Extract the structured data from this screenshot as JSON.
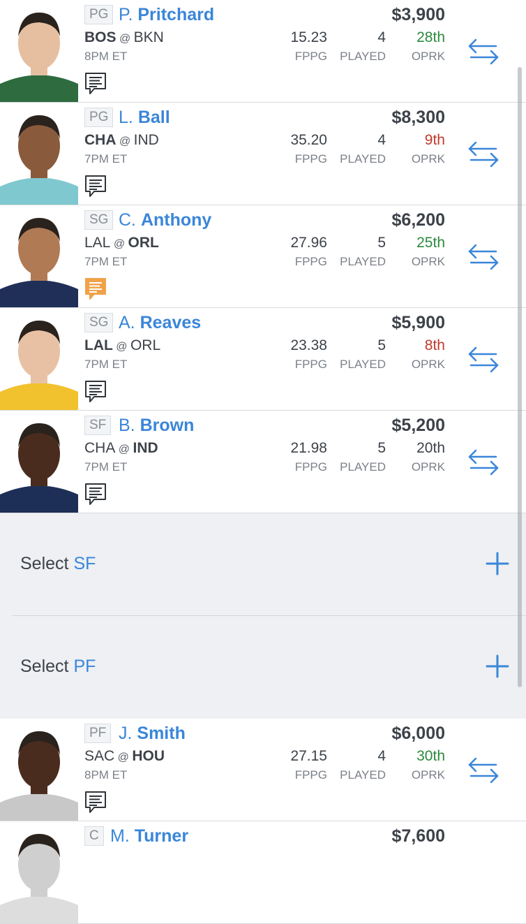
{
  "players": [
    {
      "pos": "PG",
      "initial": "P.",
      "last": "Pritchard",
      "salary": "$3,900",
      "team": "BOS",
      "opp": "BKN",
      "home_bold": "team",
      "time": "8PM ET",
      "fppg": "15.23",
      "fppg_label": "FPPG",
      "played": "4",
      "played_label": "PLAYED",
      "oprk": "28th",
      "oprk_label": "OPRK",
      "oprk_tone": "good",
      "note": "default",
      "jersey": "#2e6b3e",
      "skin": "#e6bfa0"
    },
    {
      "pos": "PG",
      "initial": "L.",
      "last": "Ball",
      "salary": "$8,300",
      "team": "CHA",
      "opp": "IND",
      "home_bold": "team",
      "time": "7PM ET",
      "fppg": "35.20",
      "fppg_label": "FPPG",
      "played": "4",
      "played_label": "PLAYED",
      "oprk": "9th",
      "oprk_label": "OPRK",
      "oprk_tone": "bad",
      "note": "default",
      "jersey": "#7fc8cf",
      "skin": "#8a5a3c"
    },
    {
      "pos": "SG",
      "initial": "C.",
      "last": "Anthony",
      "salary": "$6,200",
      "team": "LAL",
      "opp": "ORL",
      "home_bold": "opp",
      "time": "7PM ET",
      "fppg": "27.96",
      "fppg_label": "FPPG",
      "played": "5",
      "played_label": "PLAYED",
      "oprk": "25th",
      "oprk_label": "OPRK",
      "oprk_tone": "good",
      "note": "highlight",
      "jersey": "#1f2f57",
      "skin": "#b07a55"
    },
    {
      "pos": "SG",
      "initial": "A.",
      "last": "Reaves",
      "salary": "$5,900",
      "team": "LAL",
      "opp": "ORL",
      "home_bold": "team",
      "time": "7PM ET",
      "fppg": "23.38",
      "fppg_label": "FPPG",
      "played": "5",
      "played_label": "PLAYED",
      "oprk": "8th",
      "oprk_label": "OPRK",
      "oprk_tone": "bad",
      "note": "default",
      "jersey": "#f2c12e",
      "skin": "#e8c1a4"
    },
    {
      "pos": "SF",
      "initial": "B.",
      "last": "Brown",
      "salary": "$5,200",
      "team": "CHA",
      "opp": "IND",
      "home_bold": "opp",
      "time": "7PM ET",
      "fppg": "21.98",
      "fppg_label": "FPPG",
      "played": "5",
      "played_label": "PLAYED",
      "oprk": "20th",
      "oprk_label": "OPRK",
      "oprk_tone": "neutral",
      "note": "default",
      "jersey": "#1d2f56",
      "skin": "#4a2c1e"
    }
  ],
  "empty_slots": [
    {
      "prefix": "Select",
      "slot": "SF"
    },
    {
      "prefix": "Select",
      "slot": "PF"
    }
  ],
  "players_after": [
    {
      "pos": "PF",
      "initial": "J.",
      "last": "Smith",
      "salary": "$6,000",
      "team": "SAC",
      "opp": "HOU",
      "home_bold": "opp",
      "time": "8PM ET",
      "fppg": "27.15",
      "fppg_label": "FPPG",
      "played": "4",
      "played_label": "PLAYED",
      "oprk": "30th",
      "oprk_label": "OPRK",
      "oprk_tone": "good",
      "note": "default",
      "jersey": "#c8c8c8",
      "skin": "#4a2c1e"
    },
    {
      "pos": "C",
      "initial": "M.",
      "last": "Turner",
      "salary": "$7,600",
      "team": "",
      "opp": "",
      "home_bold": "team",
      "time": "",
      "fppg": "",
      "fppg_label": "",
      "played": "",
      "played_label": "",
      "oprk": "",
      "oprk_label": "",
      "oprk_tone": "neutral",
      "note": "none",
      "jersey": "#dddddd",
      "skin": "#cfcfcf"
    }
  ],
  "colors": {
    "accent": "#3a86d9",
    "note_default": "#2f343a",
    "note_highlight": "#f0a24a",
    "good": "#2b8a3e",
    "bad": "#c0392b"
  },
  "icons": {
    "swap": "swap-arrows-icon",
    "note": "notes-icon",
    "add": "plus-icon"
  }
}
